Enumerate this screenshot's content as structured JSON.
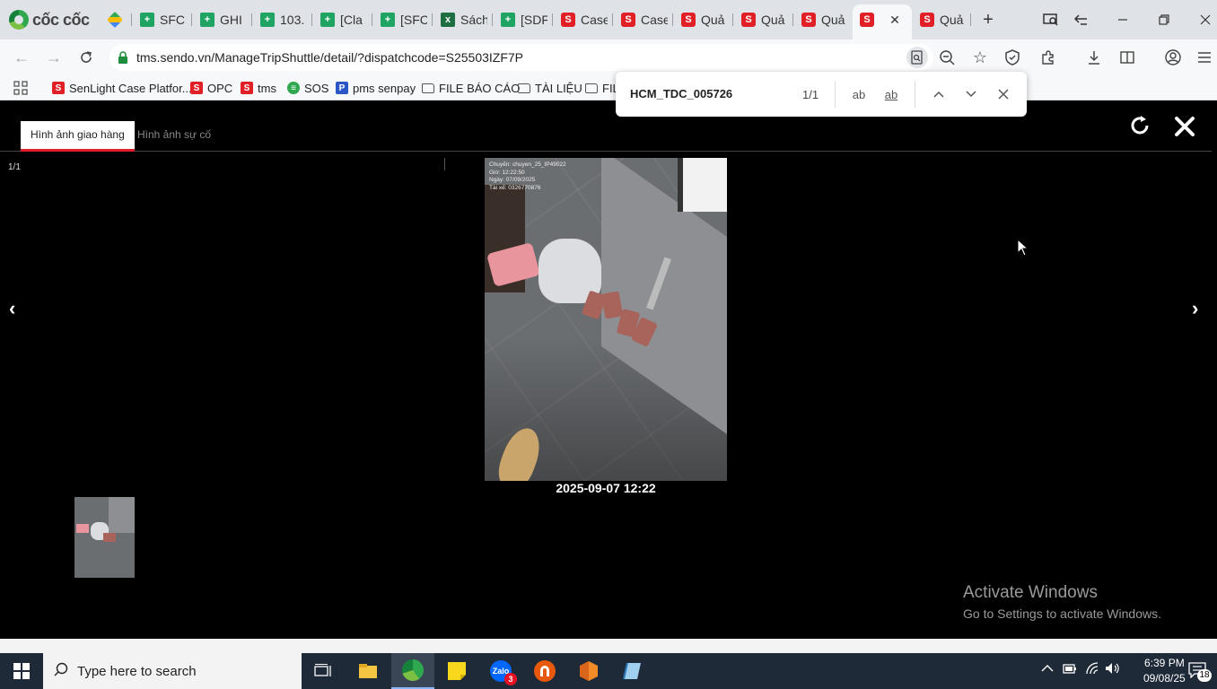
{
  "browser": {
    "brand": "cốc cốc",
    "tabs": [
      {
        "label": "",
        "icon": "drive"
      },
      {
        "label": "SFC",
        "icon": "sheet"
      },
      {
        "label": "GHI",
        "icon": "sheet"
      },
      {
        "label": "103.",
        "icon": "sheet"
      },
      {
        "label": "[Cla",
        "icon": "sheet"
      },
      {
        "label": "[SFC",
        "icon": "sheet"
      },
      {
        "label": "Sách",
        "icon": "excel"
      },
      {
        "label": "[SDF",
        "icon": "sheet"
      },
      {
        "label": "Case",
        "icon": "sendo"
      },
      {
        "label": "Case",
        "icon": "sendo"
      },
      {
        "label": "Quả",
        "icon": "sendo"
      },
      {
        "label": "Quả",
        "icon": "sendo"
      },
      {
        "label": "Quả",
        "icon": "sendo"
      },
      {
        "label": "",
        "icon": "sendo",
        "active": true
      },
      {
        "label": "Quả",
        "icon": "sendo"
      }
    ],
    "url": "tms.sendo.vn/ManageTripShuttle/detail/?dispatchcode=S25503IZF7P",
    "bookmarks": [
      {
        "label": "SenLight Case Platfor...",
        "icon": "sendo"
      },
      {
        "label": "OPC",
        "icon": "sendo"
      },
      {
        "label": "tms",
        "icon": "sendo"
      },
      {
        "label": "SOS",
        "icon": "sos"
      },
      {
        "label": "pms senpay",
        "icon": "pms"
      },
      {
        "label": "FILE BÁO CÁO",
        "icon": "folder"
      },
      {
        "label": "TÀI LIỆU",
        "icon": "folder"
      },
      {
        "label": "FIL",
        "icon": "folder"
      }
    ]
  },
  "findbar": {
    "query": "HCM_TDC_005726",
    "count": "1/1",
    "match_case": "ab",
    "whole_word": "ab"
  },
  "viewer": {
    "tabs": [
      {
        "label": "Hình ảnh giao hàng",
        "active": true
      },
      {
        "label": "Hình ảnh sự cố",
        "active": false
      }
    ],
    "counter": "1/1",
    "prev": "‹",
    "next": "›",
    "photo_overlay": [
      "Chuyến: chuyen_25_IP49022",
      "Giờ: 12:22:50",
      "Ngày: 07/09/2025",
      "Tài xế: 0326770876"
    ],
    "photo_caption": "2025-09-07 12:22"
  },
  "watermark": {
    "title": "Activate Windows",
    "subtitle": "Go to Settings to activate Windows."
  },
  "taskbar": {
    "search_placeholder": "Type here to search",
    "zalo_badge": "3",
    "time": "6:39 PM",
    "date": "09/08/25",
    "notification_count": "18"
  }
}
